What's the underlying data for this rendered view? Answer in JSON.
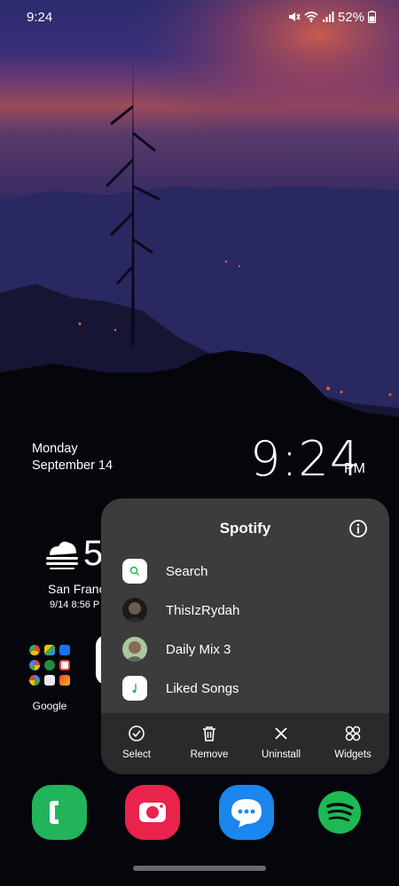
{
  "status_bar": {
    "time": "9:24",
    "battery": "52%",
    "icons": [
      "mute-icon",
      "wifi-icon",
      "signal-icon",
      "battery-icon"
    ]
  },
  "lockscreen_clock": {
    "day": "Monday",
    "date": "September 14",
    "time": "9:24",
    "ampm": "PM"
  },
  "weather_widget": {
    "temp": "5",
    "city": "San Franc",
    "updated": "9/14 8:56 P",
    "icon": "fog-icon"
  },
  "home_folder": {
    "label": "Google"
  },
  "app_popup": {
    "title": "Spotify",
    "shortcuts": [
      {
        "label": "Search",
        "icon": "search-icon"
      },
      {
        "label": "ThisIzRydah",
        "icon": "avatar"
      },
      {
        "label": "Daily Mix 3",
        "icon": "avatar"
      },
      {
        "label": "Liked Songs",
        "icon": "music-note-icon"
      }
    ],
    "actions": [
      {
        "label": "Select",
        "icon": "check-circle-icon"
      },
      {
        "label": "Remove",
        "icon": "trash-icon"
      },
      {
        "label": "Uninstall",
        "icon": "close-icon"
      },
      {
        "label": "Widgets",
        "icon": "widgets-icon"
      }
    ]
  },
  "dock": [
    {
      "name": "Phone",
      "icon": "phone-icon",
      "color": "#22b45a"
    },
    {
      "name": "Camera",
      "icon": "camera-icon",
      "color": "#e9234b"
    },
    {
      "name": "Messages",
      "icon": "message-icon",
      "color": "#1b86ee"
    },
    {
      "name": "Spotify",
      "icon": "spotify-icon",
      "color": "#1db954"
    }
  ],
  "colors": {
    "popup_bg": "#3c3c3c",
    "popup_actions_bg": "#2a2a2a",
    "spotify_green": "#1db954"
  }
}
